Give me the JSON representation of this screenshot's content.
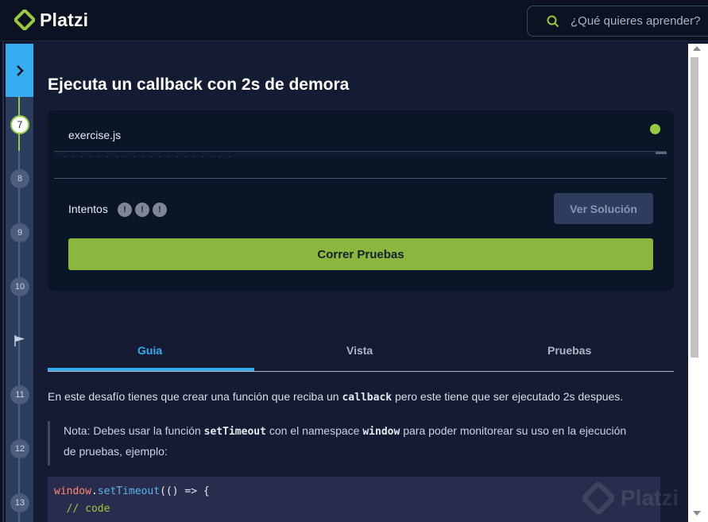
{
  "header": {
    "brand": "Platzi",
    "search_placeholder": "¿Qué quieres aprender?"
  },
  "sidebar": {
    "steps": [
      {
        "label": "7",
        "state": "active"
      },
      {
        "label": "8",
        "state": "pending"
      },
      {
        "label": "9",
        "state": "pending"
      },
      {
        "label": "10",
        "state": "pending"
      },
      {
        "label": "11",
        "state": "pending"
      },
      {
        "label": "12",
        "state": "pending"
      },
      {
        "label": "13",
        "state": "pending"
      }
    ]
  },
  "exercise": {
    "title": "Ejecuta un callback con 2s de demora",
    "file_name": "exercise.js",
    "attempts_label": "Intentos",
    "attempt_glyph": "!",
    "solution_button": "Ver Solución",
    "run_button": "Correr Pruebas"
  },
  "tabs": [
    {
      "label": "Guia",
      "active": true
    },
    {
      "label": "Vista",
      "active": false
    },
    {
      "label": "Pruebas",
      "active": false
    }
  ],
  "guide": {
    "intro_before": "En este desafío tienes que crear una función que reciba un",
    "intro_code": "callback",
    "intro_after": "pero este tiene que ser ejecutado 2s despues.",
    "note_part1": "Nota: Debes usar la función",
    "note_code1": "setTimeout",
    "note_part2": "con el namespace",
    "note_code2": "window",
    "note_part3": "para poder monitorear su uso en la ejecución",
    "note_line2": "de pruebas, ejemplo:",
    "code_window": "window",
    "code_dot": ".",
    "code_fn": "setTimeout",
    "code_rest": "(() => {",
    "code_comment": "// code"
  },
  "watermark": "Platzi",
  "colors": {
    "accent_green": "#98ca3f",
    "accent_blue": "#35acef",
    "background": "#141b33"
  }
}
